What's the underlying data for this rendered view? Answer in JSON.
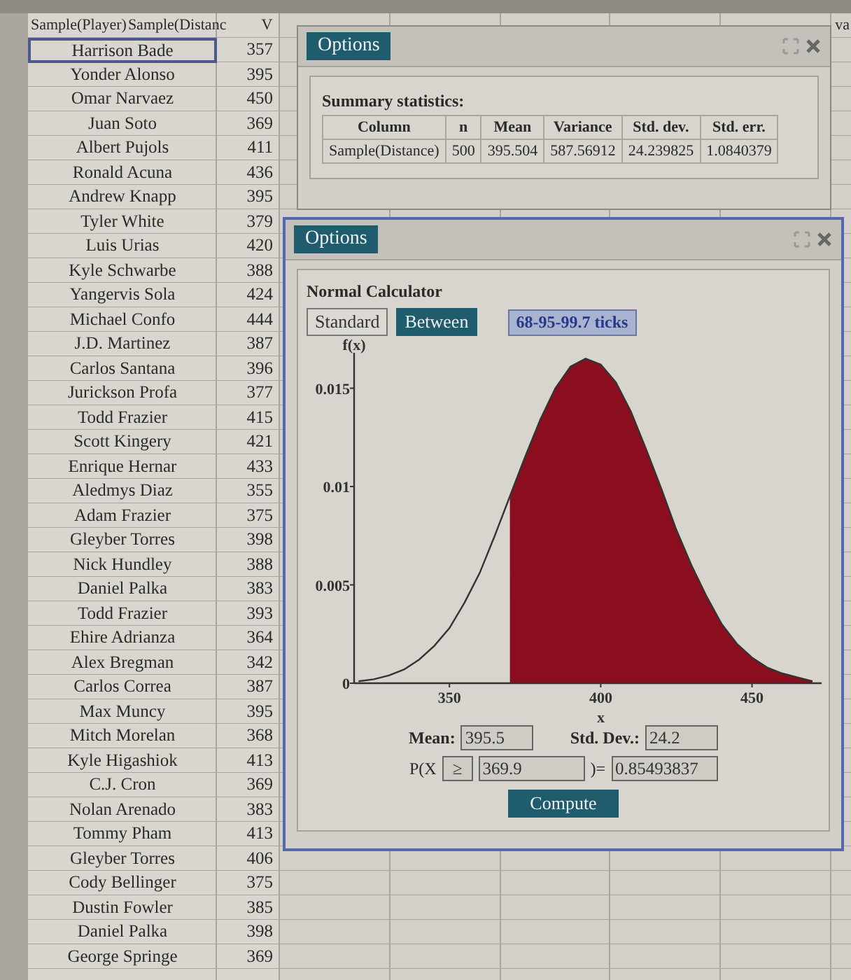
{
  "spreadsheet": {
    "columns": [
      "Sample(Player)",
      "Sample(Distanc"
    ],
    "header_fragments": [
      "V",
      "va"
    ],
    "rows": [
      {
        "player": "Harrison Bade",
        "distance": "357",
        "selected": true
      },
      {
        "player": "Yonder Alonso",
        "distance": "395",
        "selected": false
      },
      {
        "player": "Omar Narvaez",
        "distance": "450",
        "selected": false
      },
      {
        "player": "Juan Soto",
        "distance": "369",
        "selected": false
      },
      {
        "player": "Albert Pujols",
        "distance": "411",
        "selected": false
      },
      {
        "player": "Ronald Acuna",
        "distance": "436",
        "selected": false
      },
      {
        "player": "Andrew Knapp",
        "distance": "395",
        "selected": false
      },
      {
        "player": "Tyler White",
        "distance": "379",
        "selected": false
      },
      {
        "player": "Luis Urias",
        "distance": "420",
        "selected": false
      },
      {
        "player": "Kyle Schwarbe",
        "distance": "388",
        "selected": false
      },
      {
        "player": "Yangervis Sola",
        "distance": "424",
        "selected": false
      },
      {
        "player": "Michael Confo",
        "distance": "444",
        "selected": false
      },
      {
        "player": "J.D. Martinez",
        "distance": "387",
        "selected": false
      },
      {
        "player": "Carlos Santana",
        "distance": "396",
        "selected": false
      },
      {
        "player": "Jurickson Profa",
        "distance": "377",
        "selected": false
      },
      {
        "player": "Todd Frazier",
        "distance": "415",
        "selected": false
      },
      {
        "player": "Scott Kingery",
        "distance": "421",
        "selected": false
      },
      {
        "player": "Enrique Hernar",
        "distance": "433",
        "selected": false
      },
      {
        "player": "Aledmys Diaz",
        "distance": "355",
        "selected": false
      },
      {
        "player": "Adam Frazier",
        "distance": "375",
        "selected": false
      },
      {
        "player": "Gleyber Torres",
        "distance": "398",
        "selected": false
      },
      {
        "player": "Nick Hundley",
        "distance": "388",
        "selected": false
      },
      {
        "player": "Daniel Palka",
        "distance": "383",
        "selected": false
      },
      {
        "player": "Todd Frazier",
        "distance": "393",
        "selected": false
      },
      {
        "player": "Ehire Adrianza",
        "distance": "364",
        "selected": false
      },
      {
        "player": "Alex Bregman",
        "distance": "342",
        "selected": false
      },
      {
        "player": "Carlos Correa",
        "distance": "387",
        "selected": false
      },
      {
        "player": "Max Muncy",
        "distance": "395",
        "selected": false
      },
      {
        "player": "Mitch Morelan",
        "distance": "368",
        "selected": false
      },
      {
        "player": "Kyle Higashiok",
        "distance": "413",
        "selected": false
      },
      {
        "player": "C.J. Cron",
        "distance": "369",
        "selected": false
      },
      {
        "player": "Nolan Arenado",
        "distance": "383",
        "selected": false
      },
      {
        "player": "Tommy Pham",
        "distance": "413",
        "selected": false
      },
      {
        "player": "Gleyber Torres",
        "distance": "406",
        "selected": false
      },
      {
        "player": "Cody Bellinger",
        "distance": "375",
        "selected": false
      },
      {
        "player": "Dustin Fowler",
        "distance": "385",
        "selected": false
      },
      {
        "player": "Daniel Palka",
        "distance": "398",
        "selected": false
      },
      {
        "player": "George Springe",
        "distance": "369",
        "selected": false
      }
    ]
  },
  "summary_window": {
    "title": "Options",
    "heading": "Summary statistics:",
    "columns": [
      "Column",
      "n",
      "Mean",
      "Variance",
      "Std. dev.",
      "Std. err."
    ],
    "rows": [
      [
        "Sample(Distance)",
        "500",
        "395.504",
        "587.56912",
        "24.239825",
        "1.0840379"
      ]
    ]
  },
  "calculator_window": {
    "title": "Options",
    "heading": "Normal Calculator",
    "modes": [
      {
        "label": "Standard",
        "selected": false
      },
      {
        "label": "Between",
        "selected": true
      }
    ],
    "ticks_button": {
      "label": "68-95-99.7 ticks"
    },
    "chart_data": {
      "type": "line",
      "xlabel": "x",
      "ylabel": "f(x)",
      "x": [
        320,
        325,
        330,
        335,
        340,
        345,
        350,
        355,
        360,
        365,
        370,
        375,
        380,
        385,
        390,
        395,
        400,
        405,
        410,
        415,
        420,
        425,
        430,
        435,
        440,
        445,
        450,
        455,
        460,
        465,
        470
      ],
      "series": [
        {
          "color": "#333333",
          "values": [
            0.0001,
            0.0002,
            0.0004,
            0.0007,
            0.0012,
            0.0019,
            0.0028,
            0.0041,
            0.0056,
            0.0075,
            0.0095,
            0.0115,
            0.0134,
            0.015,
            0.0161,
            0.0165,
            0.0162,
            0.0153,
            0.0138,
            0.0119,
            0.0099,
            0.0078,
            0.006,
            0.0044,
            0.003,
            0.002,
            0.0013,
            0.0008,
            0.0005,
            0.0003,
            0.0001
          ]
        },
        {
          "type": "area",
          "color": "#8b0e1e",
          "values": [
            null,
            null,
            null,
            null,
            null,
            null,
            null,
            null,
            null,
            null,
            0.0095,
            0.0115,
            0.0134,
            0.015,
            0.0161,
            0.0165,
            0.0162,
            0.0153,
            0.0138,
            0.0119,
            0.0099,
            0.0078,
            0.006,
            0.0044,
            0.003,
            0.002,
            0.0013,
            0.0008,
            0.0005,
            0.0003,
            0.0001
          ]
        }
      ],
      "xlim": [
        318.5,
        473
      ],
      "ylim": [
        0,
        0.0168
      ],
      "xticks": [
        350,
        400,
        450
      ],
      "yticks": [
        0,
        0.005,
        0.01,
        0.015
      ]
    },
    "mean_label": "Mean:",
    "mean": "395.5",
    "sd_label": "Std. Dev.:",
    "sd": "24.2",
    "prob_prefix": "P(X",
    "operator": "≥",
    "bound": "369.9",
    "equals": ")=",
    "result": "0.85493837",
    "compute": "Compute"
  }
}
